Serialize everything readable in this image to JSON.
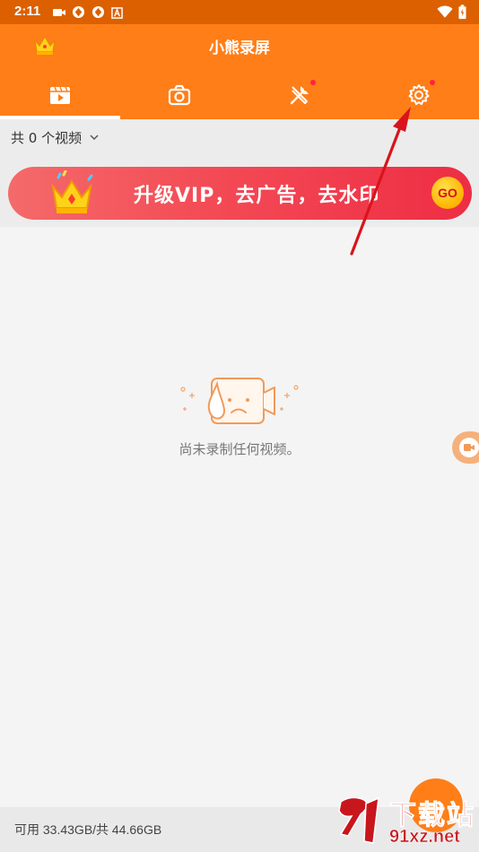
{
  "status_bar": {
    "time": "2:11",
    "icons": [
      "video-icon",
      "sync-icon",
      "sync-icon",
      "a-icon"
    ],
    "right_icons": [
      "wifi-icon",
      "battery-icon"
    ]
  },
  "header": {
    "title": "小熊录屏",
    "tabs": [
      {
        "name": "videos",
        "icon": "video-list-icon",
        "active": true,
        "badge": false
      },
      {
        "name": "screenshots",
        "icon": "camera-icon",
        "active": false,
        "badge": false
      },
      {
        "name": "tools",
        "icon": "tools-icon",
        "active": false,
        "badge": true
      },
      {
        "name": "settings",
        "icon": "gear-icon",
        "active": false,
        "badge": true
      }
    ]
  },
  "filter": {
    "label": "共 0 个视频"
  },
  "banner": {
    "text": "升级VIP，去广告，去水印",
    "go_label": "GO"
  },
  "empty": {
    "message": "尚未录制任何视频。"
  },
  "storage": {
    "text": "可用 33.43GB/共 44.66GB"
  },
  "watermark": {
    "line1": "下载站",
    "line2": "91xz.net"
  },
  "colors": {
    "header": "#ff7e18",
    "status_bar": "#dc6000",
    "banner": "#f34a55",
    "badge": "#ff2340",
    "annotation": "#d9141c"
  }
}
